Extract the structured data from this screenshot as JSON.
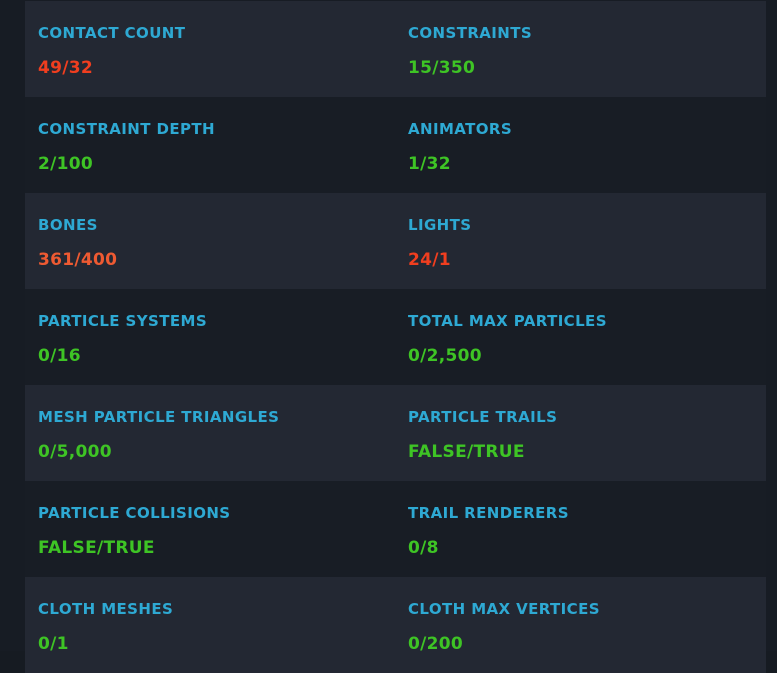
{
  "colors": {
    "label": "#2ea9d3",
    "ok": "#3ec425",
    "warn": "#ee5a32",
    "bad": "#f03e1f",
    "row_shade": "#232833",
    "row_plain": "#181d25"
  },
  "stats": [
    {
      "left": {
        "label": "CONTACT COUNT",
        "value": "49/32",
        "status": "bad"
      },
      "right": {
        "label": "CONSTRAINTS",
        "value": "15/350",
        "status": "ok"
      }
    },
    {
      "left": {
        "label": "CONSTRAINT DEPTH",
        "value": "2/100",
        "status": "ok"
      },
      "right": {
        "label": "ANIMATORS",
        "value": "1/32",
        "status": "ok"
      }
    },
    {
      "left": {
        "label": "BONES",
        "value": "361/400",
        "status": "warn"
      },
      "right": {
        "label": "LIGHTS",
        "value": "24/1",
        "status": "bad"
      }
    },
    {
      "left": {
        "label": "PARTICLE SYSTEMS",
        "value": "0/16",
        "status": "ok"
      },
      "right": {
        "label": "TOTAL MAX PARTICLES",
        "value": "0/2,500",
        "status": "ok"
      }
    },
    {
      "left": {
        "label": "MESH PARTICLE TRIANGLES",
        "value": "0/5,000",
        "status": "ok"
      },
      "right": {
        "label": "PARTICLE TRAILS",
        "value": "FALSE/TRUE",
        "status": "ok"
      }
    },
    {
      "left": {
        "label": "PARTICLE COLLISIONS",
        "value": "FALSE/TRUE",
        "status": "ok"
      },
      "right": {
        "label": "TRAIL RENDERERS",
        "value": "0/8",
        "status": "ok"
      }
    },
    {
      "left": {
        "label": "CLOTH MESHES",
        "value": "0/1",
        "status": "ok"
      },
      "right": {
        "label": "CLOTH MAX VERTICES",
        "value": "0/200",
        "status": "ok"
      }
    }
  ]
}
